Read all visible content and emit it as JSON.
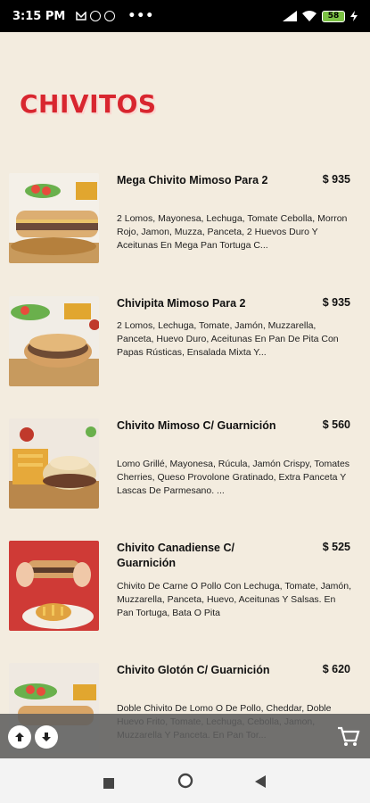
{
  "status_bar": {
    "time": "3:15 PM",
    "dots": "•••",
    "battery": "58"
  },
  "page": {
    "title": "CHIVITOS"
  },
  "items": [
    {
      "name": "Mega Chivito Mimoso Para 2",
      "price": "$ 935",
      "description": "2 Lomos, Mayonesa, Lechuga, Tomate Cebolla, Morron Rojo, Jamon, Muzza, Panceta, 2 Huevos Duro Y Aceitunas En Mega Pan Tortuga C..."
    },
    {
      "name": "Chivipita Mimoso Para 2",
      "price": "$ 935",
      "description": "2 Lomos, Lechuga, Tomate, Jamón, Muzzarella, Panceta, Huevo Duro, Aceitunas En Pan De Pita Con Papas Rústicas, Ensalada Mixta Y..."
    },
    {
      "name": "Chivito Mimoso C/ Guarnición",
      "price": "$ 560",
      "description": "Lomo Grillé, Mayonesa, Rúcula, Jamón Crispy, Tomates Cherries, Queso Provolone Gratinado, Extra Panceta Y Lascas De Parmesano. ..."
    },
    {
      "name": "Chivito Canadiense C/ Guarnición",
      "price": "$ 525",
      "description": "Chivito De Carne O Pollo Con Lechuga, Tomate, Jamón, Muzzarella, Panceta, Huevo, Aceitunas Y Salsas. En Pan Tortuga, Bata O Pita"
    },
    {
      "name": "Chivito Glotón C/ Guarnición",
      "price": "$ 620",
      "description": "Doble Chivito De Lomo O De Pollo, Cheddar, Doble Huevo Frito, Tomate, Lechuga, Cebolla, Jamon, Muzzarella Y Panceta. En Pan Tor..."
    }
  ],
  "icons": {
    "up": "arrow-up-icon",
    "down": "arrow-down-icon",
    "cart": "cart-icon",
    "stop": "nav-square-icon",
    "home": "nav-home-icon",
    "back": "nav-back-icon"
  },
  "colors": {
    "background": "#f3ecdf",
    "title": "#d8262f",
    "bottom_bar": "#5f5f5f"
  }
}
